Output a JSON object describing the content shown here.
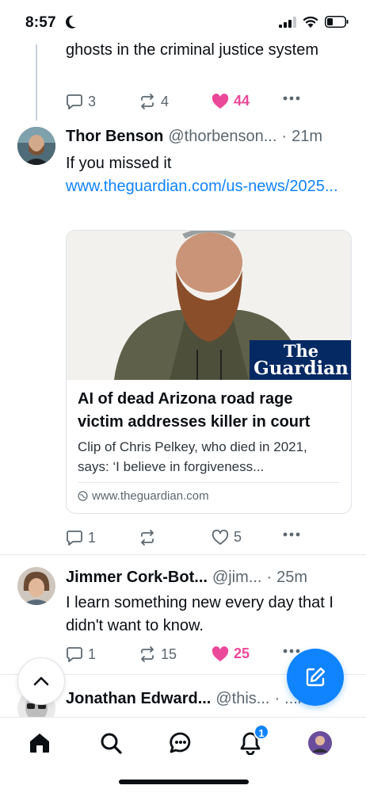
{
  "status_bar": {
    "time": "8:57",
    "moon_icon": "moon-icon",
    "signal_icon": "cellular-signal-icon",
    "wifi_icon": "wifi-icon",
    "battery_icon": "battery-icon"
  },
  "colors": {
    "accent": "#1083fe",
    "like": "#ec4899",
    "muted": "#5b6770",
    "text": "#0b0f14"
  },
  "posts": [
    {
      "text": "ghosts in the criminal justice system",
      "actions": {
        "replies": "3",
        "reposts": "4",
        "likes": "44",
        "liked": true
      }
    },
    {
      "author": "Thor Benson",
      "handle": "@thorbenson...",
      "time": "21m",
      "text": "If you missed it",
      "link": "www.theguardian.com/us-news/2025...",
      "card": {
        "image_logo_line1": "The",
        "image_logo_line2": "Guardian",
        "title": "AI of dead Arizona road rage victim addresses killer in court",
        "description": "Clip of Chris Pelkey, who died in 2021, says: ‘I believe in forgiveness...",
        "domain": "www.theguardian.com"
      },
      "actions": {
        "replies": "1",
        "reposts": "",
        "likes": "5",
        "liked": false
      }
    },
    {
      "author": "Jimmer Cork-Bot...",
      "handle": "@jim...",
      "time": "25m",
      "text": "I learn something new every day that I didn't want to know.",
      "actions": {
        "replies": "1",
        "reposts": "15",
        "likes": "25",
        "liked": true
      }
    },
    {
      "author": "Jonathan Edward...",
      "handle": "@this...",
      "time": "...m"
    }
  ],
  "nav": {
    "items": [
      "home-icon",
      "search-icon",
      "chat-icon",
      "notifications-icon",
      "profile-avatar"
    ],
    "notification_badge": "1"
  }
}
